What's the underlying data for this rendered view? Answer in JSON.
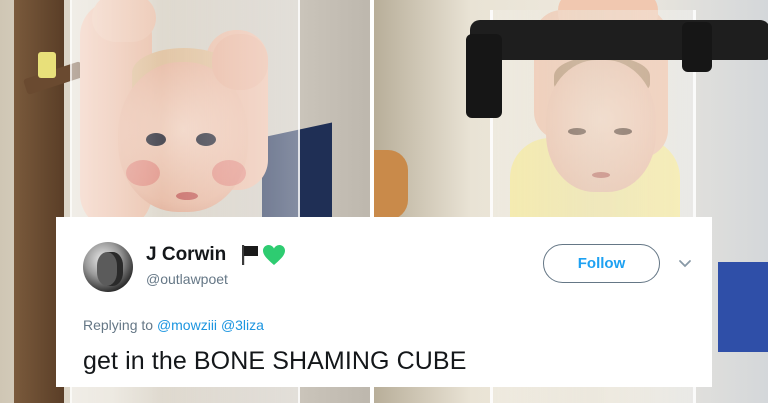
{
  "tweet": {
    "display_name": "J Corwin",
    "handle": "@outlawpoet",
    "follow_label": "Follow",
    "replying_prefix": "Replying to",
    "replying_to": [
      "@mowziii",
      "@3liza"
    ],
    "text": "get in the BONE SHAMING CUBE",
    "name_emoji_icons": [
      "black-flag-icon",
      "green-heart-icon"
    ],
    "accent_color": "#1da1f2",
    "heart_color": "#2ecc71"
  },
  "photos": [
    {
      "name": "left-photo",
      "subject": "baby-in-tube-left"
    },
    {
      "name": "right-photo",
      "subject": "baby-in-tube-right"
    }
  ]
}
